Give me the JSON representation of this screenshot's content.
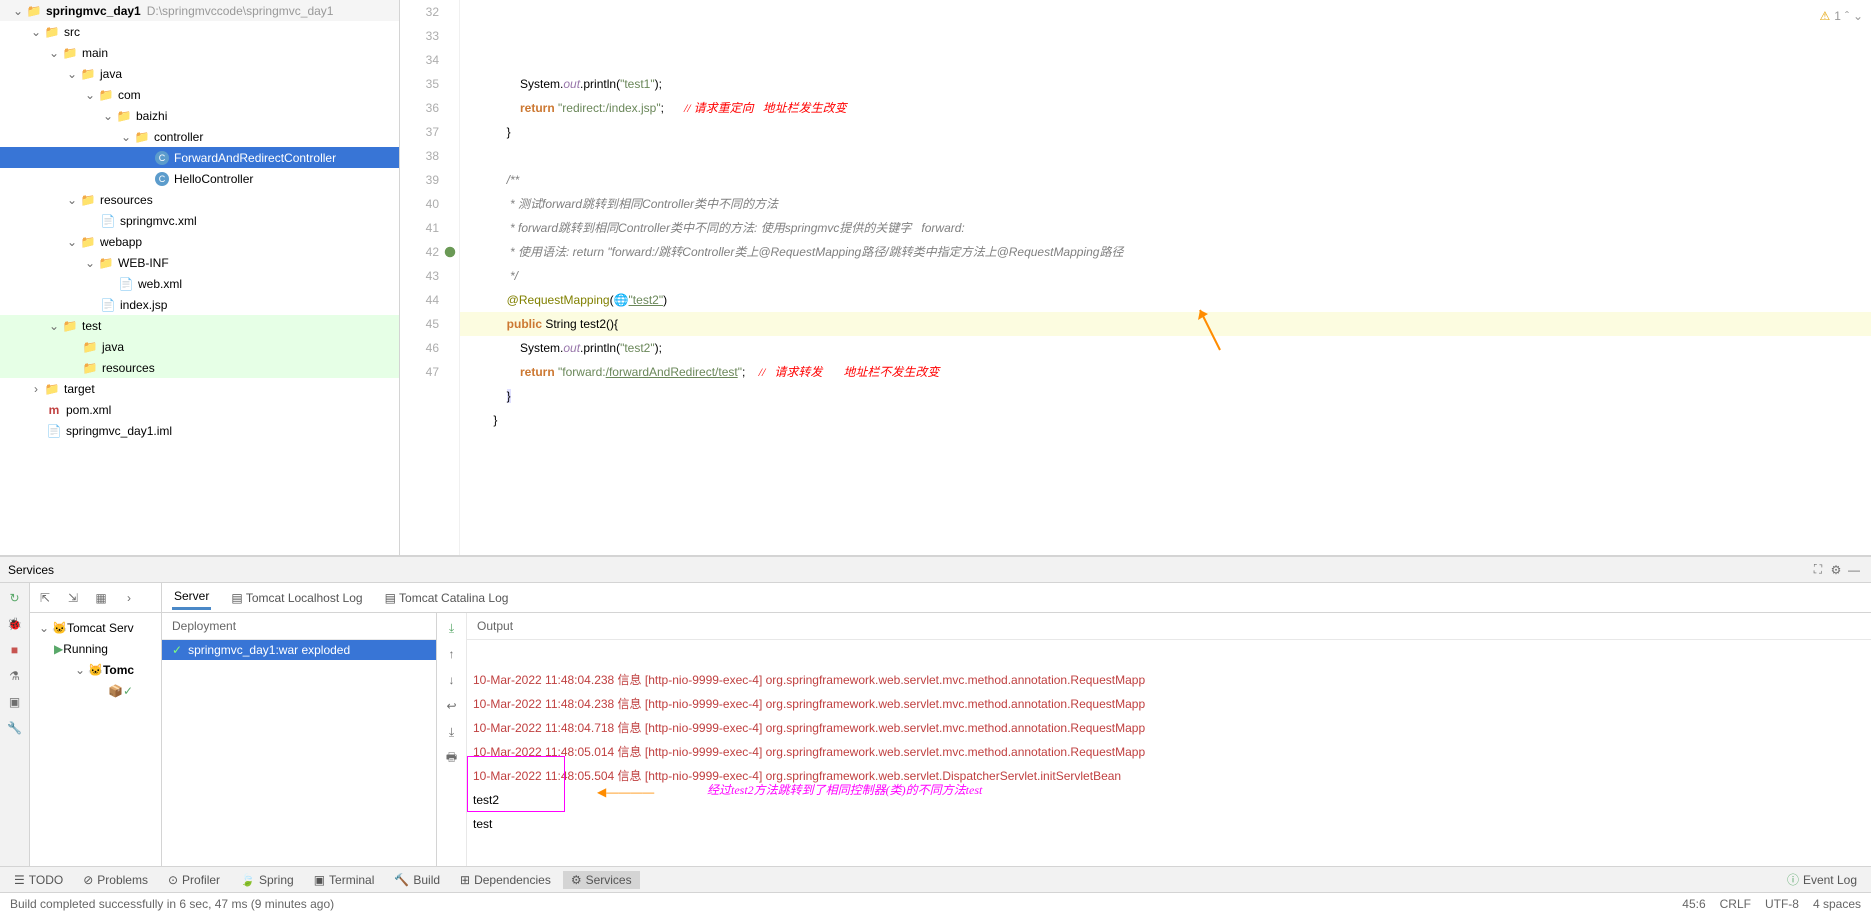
{
  "project": {
    "root": "springmvc_day1",
    "rootPath": "D:\\springmvccode\\springmvc_day1",
    "src": "src",
    "main": "main",
    "java": "java",
    "com": "com",
    "baizhi": "baizhi",
    "controller": "controller",
    "file1": "ForwardAndRedirectController",
    "file2": "HelloController",
    "resources": "resources",
    "springxml": "springmvc.xml",
    "webapp": "webapp",
    "webinf": "WEB-INF",
    "webxml": "web.xml",
    "indexjsp": "index.jsp",
    "test": "test",
    "testjava": "java",
    "testres": "resources",
    "target": "target",
    "pom": "pom.xml",
    "iml": "springmvc_day1.iml"
  },
  "editor": {
    "lines": [
      "32",
      "33",
      "34",
      "35",
      "36",
      "37",
      "38",
      "39",
      "40",
      "41",
      "42",
      "43",
      "44",
      "45",
      "46",
      "47"
    ],
    "warnCount": "1"
  },
  "code": {
    "l32a": "System.",
    "l32b": "out",
    "l32c": ".println(",
    "l32d": "\"test1\"",
    "l32e": ");",
    "l33a": "return ",
    "l33b": "\"redirect:/index.jsp\"",
    "l33c": ";",
    "l33d": "// 请求重定向   地址栏发生改变",
    "l34": "}",
    "l36": "/**",
    "l37": " * 测试forward跳转到相同Controller类中不同的方法",
    "l38": " * forward跳转到相同Controller类中不同的方法: 使用springmvc提供的关键字   forward:",
    "l39": " * 使用语法: return \"forward:/跳转Controller类上@RequestMapping路径/跳转类中指定方法上@RequestMapping路径",
    "l40": " */",
    "l41a": "@RequestMapping",
    "l41b": "(",
    "l41c": "\"test2\"",
    "l41d": ")",
    "l42a": "public ",
    "l42b": "String ",
    "l42c": "test2(){",
    "l43a": "System.",
    "l43b": "out",
    "l43c": ".println(",
    "l43d": "\"test2\"",
    "l43e": ");",
    "l44a": "return ",
    "l44b": "\"forward:",
    "l44c": "/forwardAndRedirect/test",
    "l44d": "\"",
    "l44e": ";",
    "l44f": "//   请求转发       地址栏不发生改变",
    "l45": "}",
    "l46": "}"
  },
  "services": {
    "title": "Services",
    "tabs": {
      "server": "Server",
      "tl": "Tomcat Localhost Log",
      "cl": "Tomcat Catalina Log"
    },
    "tree": {
      "root": "Tomcat Serv",
      "running": "Running",
      "item": "Tomc"
    },
    "deploy": {
      "head": "Deployment",
      "item": "springmvc_day1:war exploded"
    },
    "output": {
      "head": "Output",
      "lines": [
        "10-Mar-2022 11:48:04.238 信息 [http-nio-9999-exec-4] org.springframework.web.servlet.mvc.method.annotation.RequestMapp",
        "10-Mar-2022 11:48:04.238 信息 [http-nio-9999-exec-4] org.springframework.web.servlet.mvc.method.annotation.RequestMapp",
        "10-Mar-2022 11:48:04.718 信息 [http-nio-9999-exec-4] org.springframework.web.servlet.mvc.method.annotation.RequestMapp",
        "10-Mar-2022 11:48:05.014 信息 [http-nio-9999-exec-4] org.springframework.web.servlet.mvc.method.annotation.RequestMapp",
        "10-Mar-2022 11:48:05.504 信息 [http-nio-9999-exec-4] org.springframework.web.servlet.DispatcherServlet.initServletBean"
      ],
      "t1": "test2",
      "t2": "test",
      "note": "经过test2方法跳转到了相同控制器(类)的不同方法test"
    }
  },
  "bottombar": {
    "todo": "TODO",
    "problems": "Problems",
    "profiler": "Profiler",
    "spring": "Spring",
    "terminal": "Terminal",
    "build": "Build",
    "deps": "Dependencies",
    "services": "Services",
    "eventlog": "Event Log"
  },
  "status": {
    "msg": "Build completed successfully in 6 sec, 47 ms (9 minutes ago)",
    "pos": "45:6",
    "sep": "CRLF",
    "enc": "UTF-8",
    "ind": "4 spaces"
  }
}
